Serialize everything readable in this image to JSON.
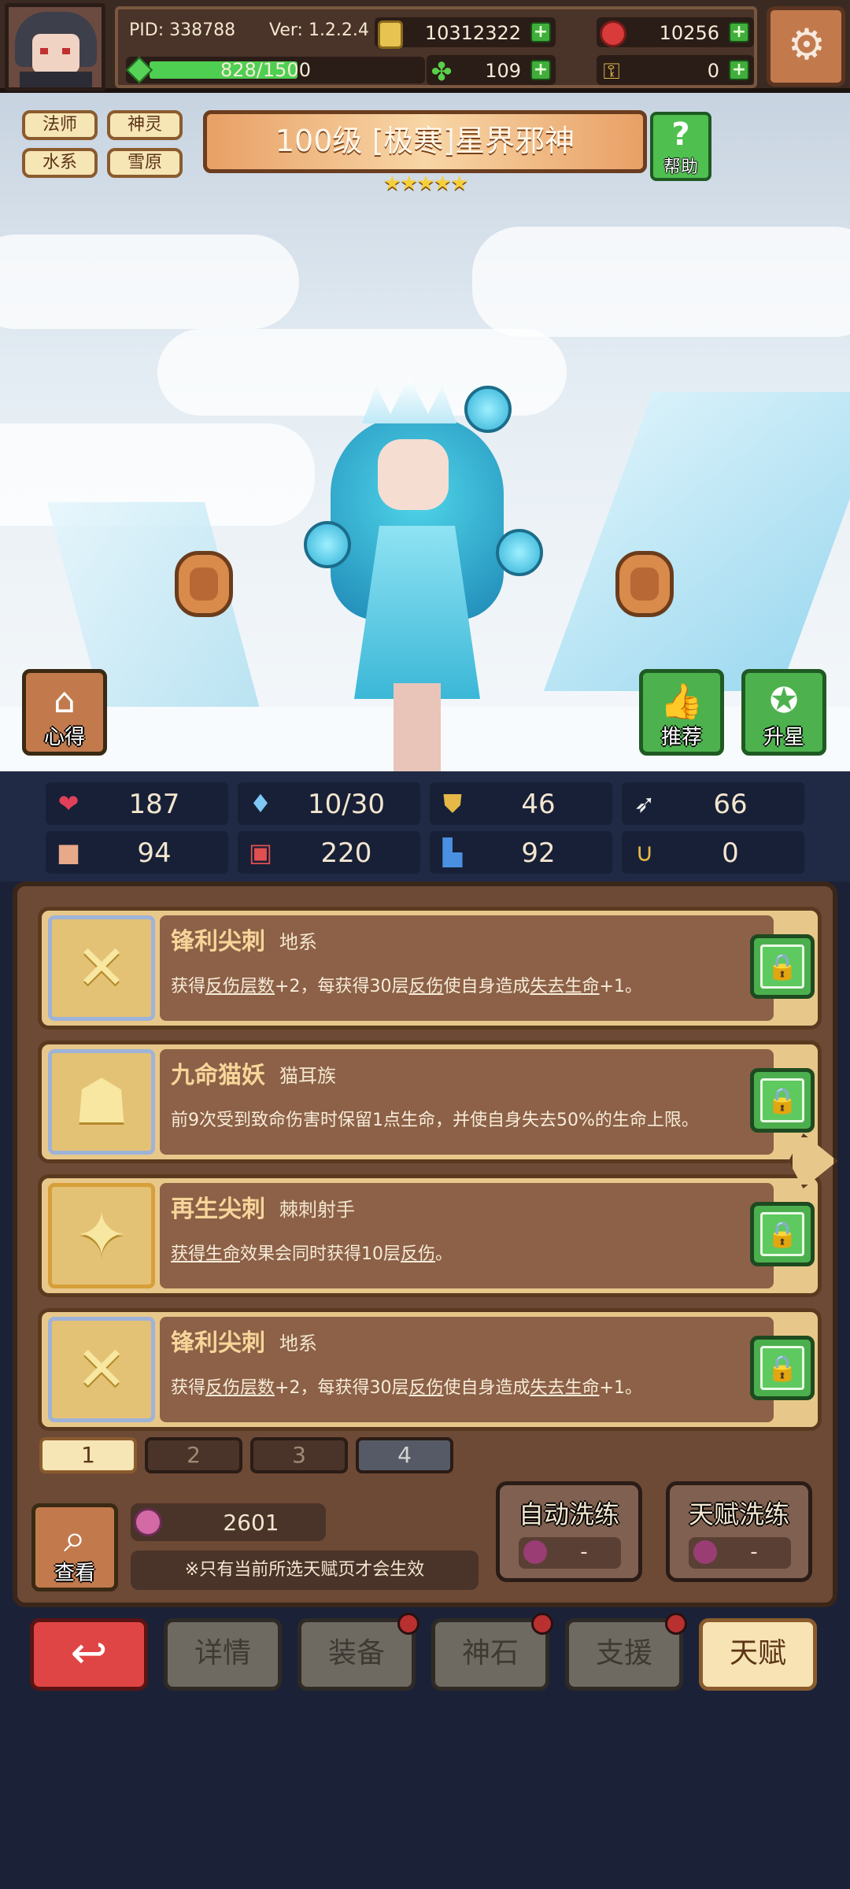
{
  "header": {
    "pid": "PID: 338788",
    "version": "Ver: 1.2.2.4",
    "gold": "10312322",
    "ruby": "10256",
    "stamina": "828/1500",
    "stamina_fraction": 0.552,
    "clover": "109",
    "key": "0",
    "plus_glyph": "+",
    "settings_icon": "gear-icon"
  },
  "scene": {
    "tags": [
      "法师",
      "神灵",
      "水系",
      "雪原"
    ],
    "title": "100级 [极寒]星界邪神",
    "star_count": 5,
    "stars": "★★★★★",
    "help": {
      "icon": "?",
      "label": "帮助"
    },
    "experience_btn": {
      "label": "心得"
    },
    "recommend_btn": {
      "label": "推荐"
    },
    "upstar_btn": {
      "label": "升星"
    }
  },
  "stats": [
    {
      "icon": "heart-icon",
      "glyph": "❤",
      "color": "#e0405a",
      "value": "187"
    },
    {
      "icon": "water-drop-icon",
      "glyph": "💧",
      "color": "#7fc7f5",
      "value": "10/30"
    },
    {
      "icon": "shield-icon",
      "glyph": "⛊",
      "color": "#e5b848",
      "value": "46"
    },
    {
      "icon": "wing-icon",
      "glyph": "➶",
      "color": "#f0f0f0",
      "value": "66"
    },
    {
      "icon": "fist-icon",
      "glyph": "✊",
      "color": "#e8a88a",
      "value": "94"
    },
    {
      "icon": "book-icon",
      "glyph": "📖",
      "color": "#e05050",
      "value": "220"
    },
    {
      "icon": "boot-icon",
      "glyph": "👢",
      "color": "#4a90e0",
      "value": "92"
    },
    {
      "icon": "horseshoe-icon",
      "glyph": "∪",
      "color": "#e5b848",
      "value": "0"
    }
  ],
  "talents": [
    {
      "name": "锋利尖刺",
      "subtitle": "地系",
      "desc_parts": [
        "获得",
        "反伤层数",
        "+2，每获得30层",
        "反伤",
        "使自身造成",
        "失去生命",
        "+1。"
      ]
    },
    {
      "name": "九命猫妖",
      "subtitle": "猫耳族",
      "desc_parts": [
        "前9次受到致命伤害时保留1点生命，并使自身失去50%的生命上限。"
      ]
    },
    {
      "name": "再生尖刺",
      "subtitle": "棘刺射手",
      "desc_parts": [
        "",
        "获得生命",
        "效果会同时获得10层",
        "反伤",
        "。"
      ]
    },
    {
      "name": "锋利尖刺",
      "subtitle": "地系",
      "desc_parts": [
        "获得",
        "反伤层数",
        "+2，每获得30层",
        "反伤",
        "使自身造成",
        "失去生命",
        "+1。"
      ]
    }
  ],
  "pages": [
    "1",
    "2",
    "3",
    "4"
  ],
  "bottom_panel": {
    "view_label": "查看",
    "fruit_count": "2601",
    "note": "※只有当前所选天赋页才会生效",
    "auto_wash": {
      "label": "自动洗练",
      "cost": "-"
    },
    "talent_wash": {
      "label": "天赋洗练",
      "cost": "-"
    }
  },
  "nav": {
    "back_glyph": "↩",
    "items": [
      "详情",
      "装备",
      "神石",
      "支援",
      "天赋"
    ],
    "active": "天赋"
  }
}
